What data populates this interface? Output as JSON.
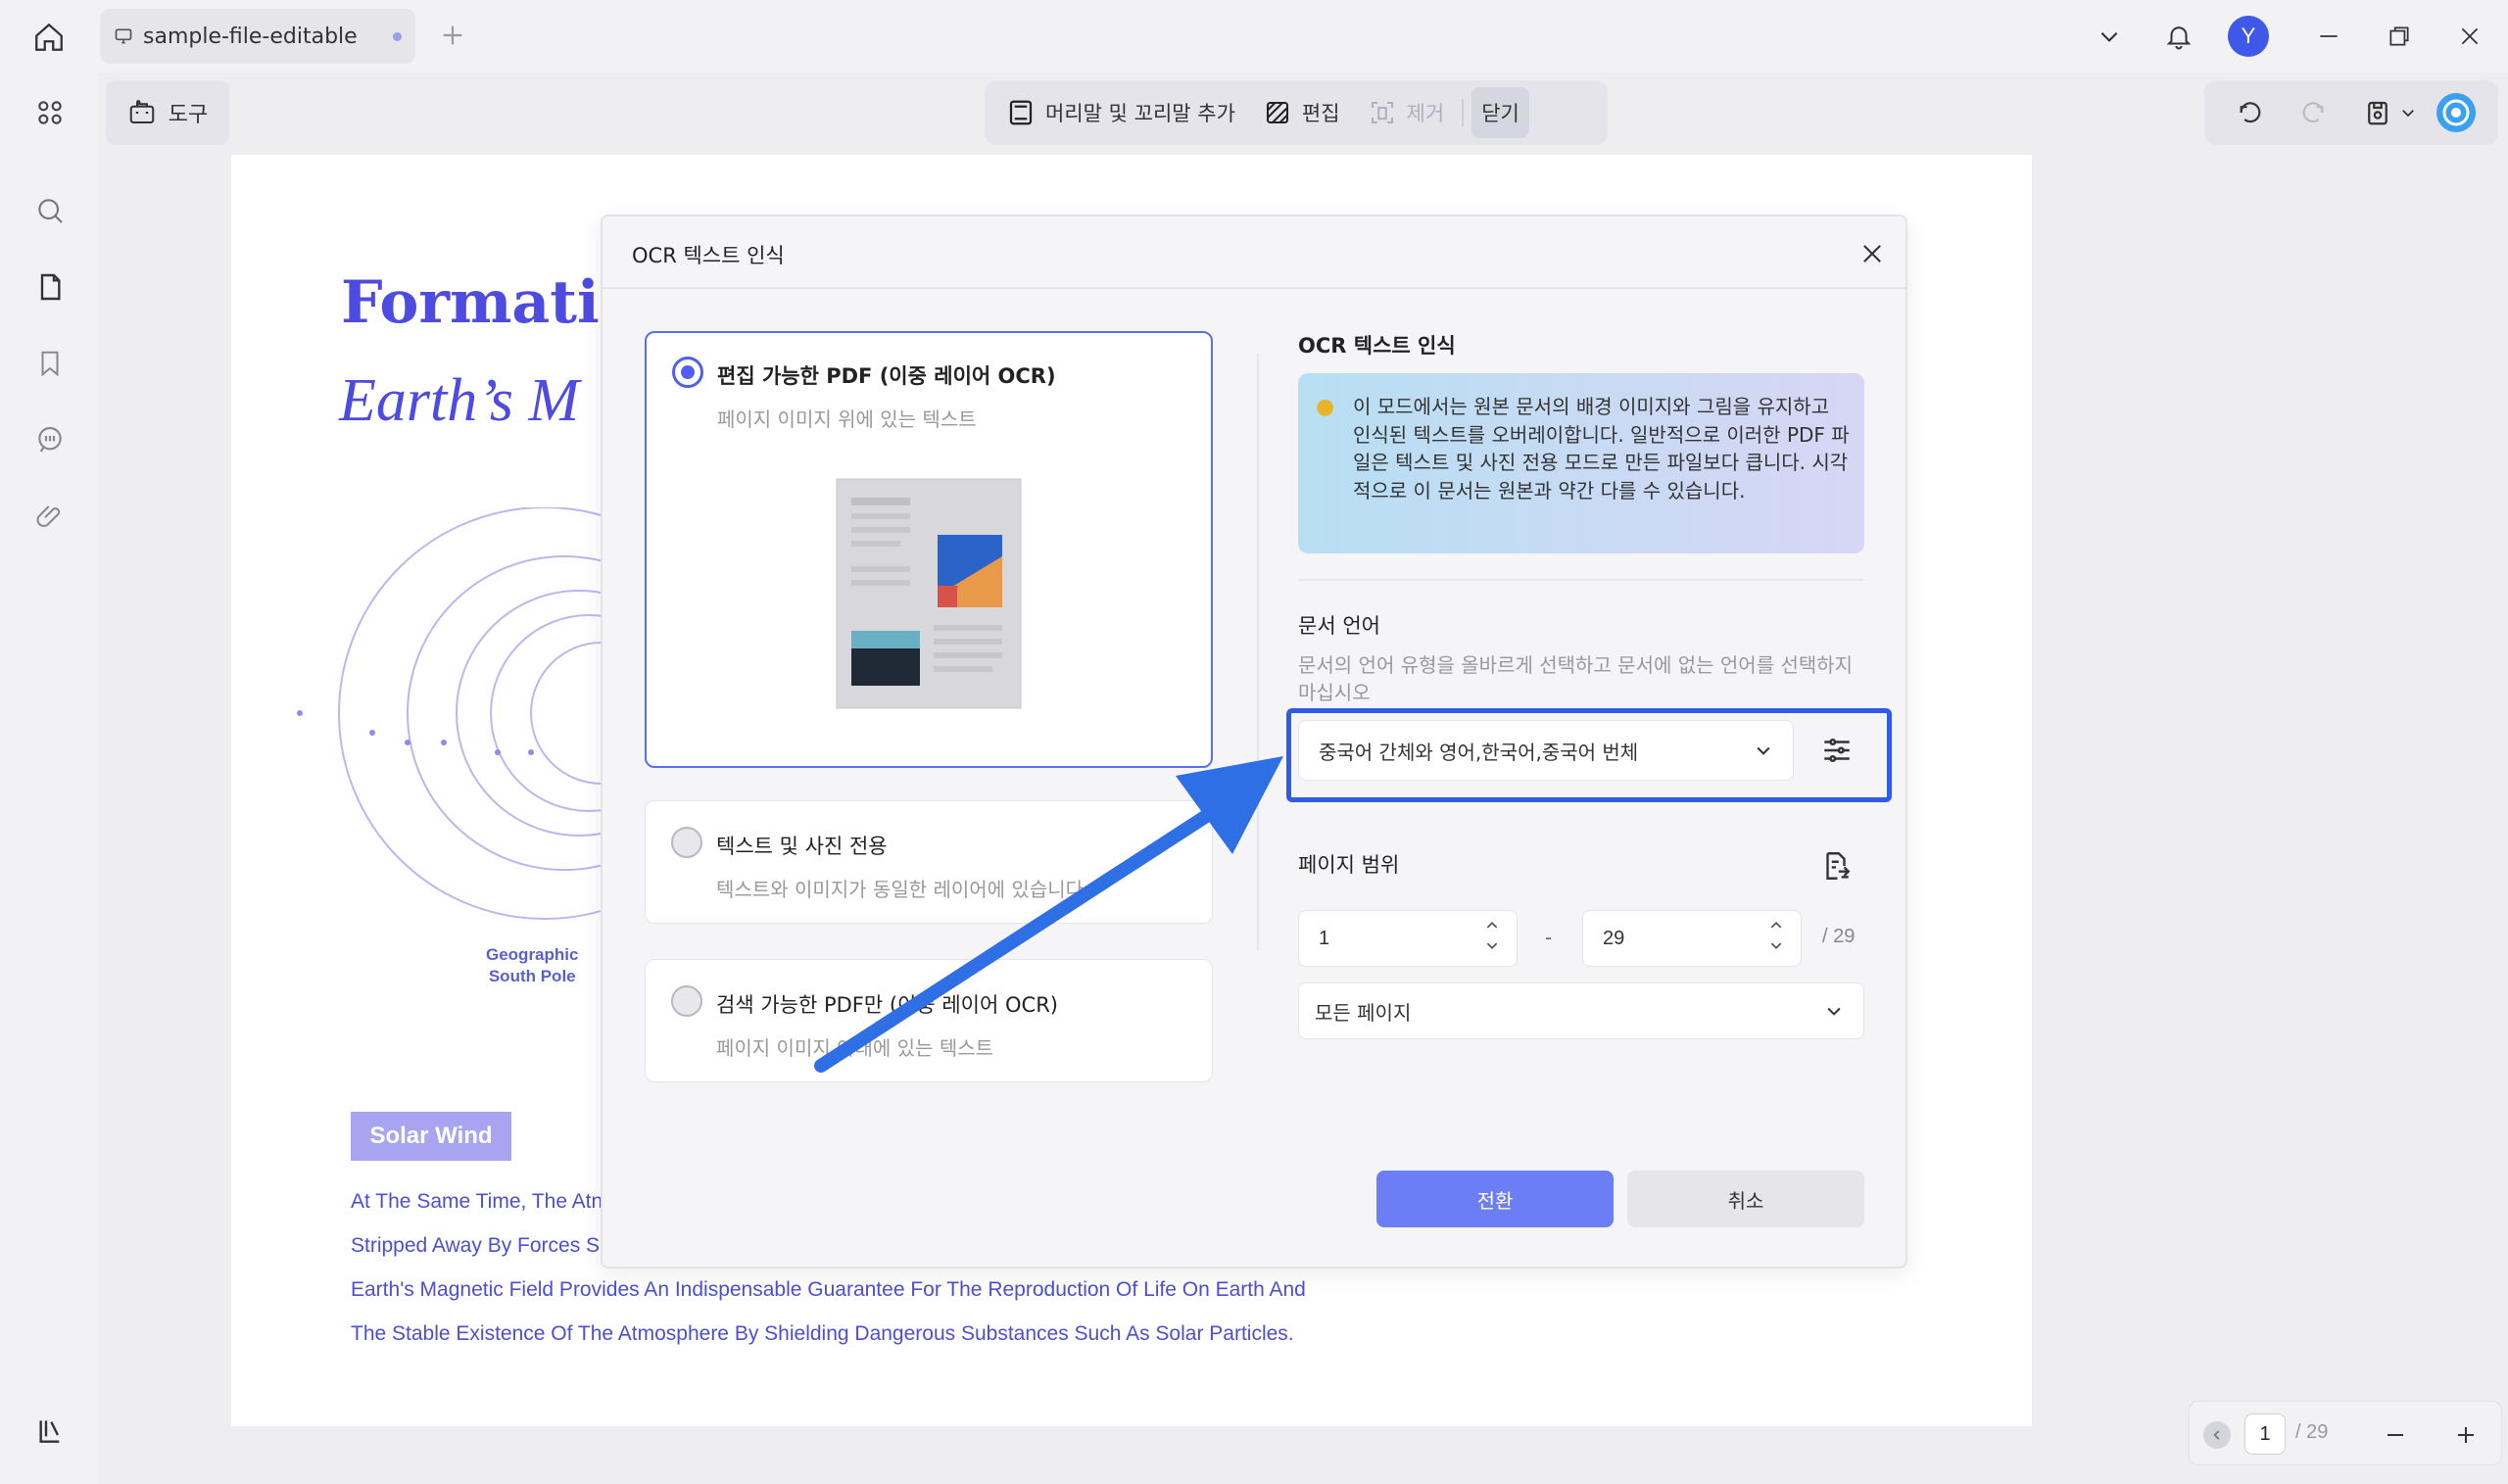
{
  "window": {
    "tab_title": "sample-file-editable",
    "avatar_letter": "Y"
  },
  "toolbar": {
    "tools_label": "도구",
    "header_footer_label": "머리말 및 꼬리말 추가",
    "edit_label": "편집",
    "remove_label": "제거",
    "close_label": "닫기"
  },
  "document": {
    "title": "Formatio",
    "subtitle": "Earth’s M",
    "geo_label_line1": "Geographic",
    "geo_label_line2": "South Pole",
    "solar_wind": "Solar Wind",
    "para_lines": [
      "At The Same Time, The Atn",
      "Stripped Away By Forces S",
      "Earth's Magnetic Field Provides An Indispensable Guarantee For The Reproduction Of Life On Earth And",
      "The Stable Existence Of The Atmosphere By Shielding Dangerous Substances Such As Solar Particles."
    ]
  },
  "page_nav": {
    "current": "1",
    "total": "/ 29"
  },
  "dialog": {
    "title": "OCR 텍스트 인식",
    "options": [
      {
        "title": "편집 가능한 PDF (이중 레이어 OCR)",
        "desc": "페이지 이미지 위에 있는 텍스트",
        "selected": true
      },
      {
        "title": "텍스트 및 사진 전용",
        "desc": "텍스트와 이미지가 동일한 레이어에 있습니다.",
        "selected": false
      },
      {
        "title": "검색 가능한 PDF만 (이중 레이어 OCR)",
        "desc": "페이지 이미지 아래에 있는 텍스트",
        "selected": false
      }
    ],
    "ocr_section_title": "OCR 텍스트 인식",
    "info_text": "이 모드에서는 원본 문서의 배경 이미지와 그림을 유지하고 인식된 텍스트를 오버레이합니다. 일반적으로 이러한 PDF 파일은 텍스트 및 사진 전용 모드로 만든 파일보다 큽니다. 시각적으로 이 문서는 원본과 약간 다를 수 있습니다.",
    "language_title": "문서 언어",
    "language_desc": "문서의 언어 유형을 올바르게 선택하고 문서에 없는 언어를 선택하지 마십시오",
    "language_value": "중국어 간체와 영어,한국어,중국어 번체",
    "page_range_title": "페이지 범위",
    "range_from": "1",
    "range_dash": "-",
    "range_to": "29",
    "range_total": "/ 29",
    "page_select_value": "모든 페이지",
    "convert_label": "전환",
    "cancel_label": "취소"
  },
  "colors": {
    "accent": "#4f5ff0",
    "highlight_border": "#2f5be7",
    "arrow": "#2f6fe6",
    "doc_text": "#4b4fd0"
  }
}
